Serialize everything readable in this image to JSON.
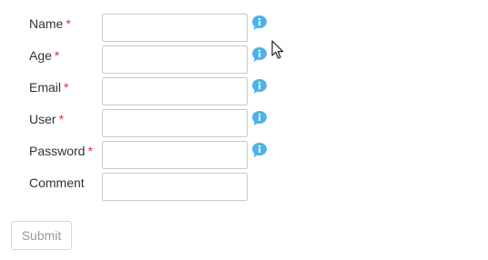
{
  "form": {
    "fields": [
      {
        "label": "Name",
        "required_mark": "*",
        "value": "",
        "has_info_icon": true
      },
      {
        "label": "Age",
        "required_mark": "*",
        "value": "",
        "has_info_icon": true
      },
      {
        "label": "Email",
        "required_mark": "*",
        "value": "",
        "has_info_icon": true
      },
      {
        "label": "User",
        "required_mark": "*",
        "value": "",
        "has_info_icon": true
      },
      {
        "label": "Password",
        "required_mark": "*",
        "value": "",
        "has_info_icon": true
      },
      {
        "label": "Comment",
        "required_mark": "",
        "value": "",
        "has_info_icon": false
      }
    ],
    "submit_label": "Submit"
  },
  "icons": {
    "info": "info-speech-bubble-icon",
    "cursor": "mouse-pointer-icon"
  },
  "colors": {
    "required": "#e03131",
    "info_icon": "#4fb3e8",
    "input_border": "#c9c9c9",
    "button_text": "#9a9a9a"
  }
}
